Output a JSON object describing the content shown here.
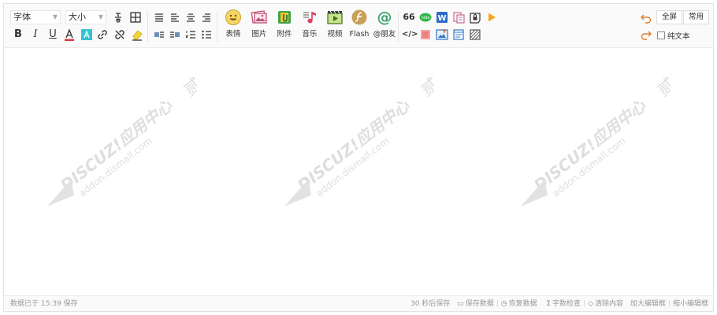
{
  "toolbar": {
    "font_select": "字体",
    "size_select": "大小",
    "media": [
      {
        "key": "emoji",
        "label": "表情"
      },
      {
        "key": "image",
        "label": "图片"
      },
      {
        "key": "attach",
        "label": "附件"
      },
      {
        "key": "music",
        "label": "音乐"
      },
      {
        "key": "video",
        "label": "视频"
      },
      {
        "key": "flash",
        "label": "Flash"
      },
      {
        "key": "at",
        "label": "@朋友"
      }
    ],
    "at_glyph": "@",
    "quote_glyph": "66",
    "code_glyph": "</>",
    "fullscreen_label": "全屏",
    "common_label": "常用",
    "plain_text_label": "纯文本"
  },
  "watermark": {
    "line1": "DISCUZ!应用中心",
    "line2": "addon.dismall.com",
    "brand": "贰道"
  },
  "status": {
    "saved_text": "数据已于 15:39 保存",
    "autosave_text": "30 秒后保存",
    "save_data": "保存数据",
    "restore_data": "恢复数据",
    "word_check": "字数检查",
    "clear_content": "清除内容",
    "enlarge": "加大编辑框",
    "shrink": "缩小编辑框"
  },
  "colors": {
    "accent": "#35c4cf",
    "font_color_red": "#e0383e",
    "highlight_yellow": "#f3d33b"
  }
}
